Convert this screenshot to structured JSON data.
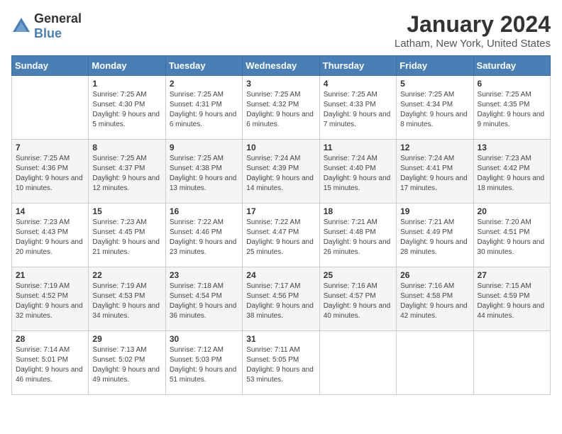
{
  "logo": {
    "general": "General",
    "blue": "Blue"
  },
  "title": "January 2024",
  "subtitle": "Latham, New York, United States",
  "headers": [
    "Sunday",
    "Monday",
    "Tuesday",
    "Wednesday",
    "Thursday",
    "Friday",
    "Saturday"
  ],
  "weeks": [
    [
      {
        "date": "",
        "sunrise": "",
        "sunset": "",
        "daylight": ""
      },
      {
        "date": "1",
        "sunrise": "Sunrise: 7:25 AM",
        "sunset": "Sunset: 4:30 PM",
        "daylight": "Daylight: 9 hours and 5 minutes."
      },
      {
        "date": "2",
        "sunrise": "Sunrise: 7:25 AM",
        "sunset": "Sunset: 4:31 PM",
        "daylight": "Daylight: 9 hours and 6 minutes."
      },
      {
        "date": "3",
        "sunrise": "Sunrise: 7:25 AM",
        "sunset": "Sunset: 4:32 PM",
        "daylight": "Daylight: 9 hours and 6 minutes."
      },
      {
        "date": "4",
        "sunrise": "Sunrise: 7:25 AM",
        "sunset": "Sunset: 4:33 PM",
        "daylight": "Daylight: 9 hours and 7 minutes."
      },
      {
        "date": "5",
        "sunrise": "Sunrise: 7:25 AM",
        "sunset": "Sunset: 4:34 PM",
        "daylight": "Daylight: 9 hours and 8 minutes."
      },
      {
        "date": "6",
        "sunrise": "Sunrise: 7:25 AM",
        "sunset": "Sunset: 4:35 PM",
        "daylight": "Daylight: 9 hours and 9 minutes."
      }
    ],
    [
      {
        "date": "7",
        "sunrise": "Sunrise: 7:25 AM",
        "sunset": "Sunset: 4:36 PM",
        "daylight": "Daylight: 9 hours and 10 minutes."
      },
      {
        "date": "8",
        "sunrise": "Sunrise: 7:25 AM",
        "sunset": "Sunset: 4:37 PM",
        "daylight": "Daylight: 9 hours and 12 minutes."
      },
      {
        "date": "9",
        "sunrise": "Sunrise: 7:25 AM",
        "sunset": "Sunset: 4:38 PM",
        "daylight": "Daylight: 9 hours and 13 minutes."
      },
      {
        "date": "10",
        "sunrise": "Sunrise: 7:24 AM",
        "sunset": "Sunset: 4:39 PM",
        "daylight": "Daylight: 9 hours and 14 minutes."
      },
      {
        "date": "11",
        "sunrise": "Sunrise: 7:24 AM",
        "sunset": "Sunset: 4:40 PM",
        "daylight": "Daylight: 9 hours and 15 minutes."
      },
      {
        "date": "12",
        "sunrise": "Sunrise: 7:24 AM",
        "sunset": "Sunset: 4:41 PM",
        "daylight": "Daylight: 9 hours and 17 minutes."
      },
      {
        "date": "13",
        "sunrise": "Sunrise: 7:23 AM",
        "sunset": "Sunset: 4:42 PM",
        "daylight": "Daylight: 9 hours and 18 minutes."
      }
    ],
    [
      {
        "date": "14",
        "sunrise": "Sunrise: 7:23 AM",
        "sunset": "Sunset: 4:43 PM",
        "daylight": "Daylight: 9 hours and 20 minutes."
      },
      {
        "date": "15",
        "sunrise": "Sunrise: 7:23 AM",
        "sunset": "Sunset: 4:45 PM",
        "daylight": "Daylight: 9 hours and 21 minutes."
      },
      {
        "date": "16",
        "sunrise": "Sunrise: 7:22 AM",
        "sunset": "Sunset: 4:46 PM",
        "daylight": "Daylight: 9 hours and 23 minutes."
      },
      {
        "date": "17",
        "sunrise": "Sunrise: 7:22 AM",
        "sunset": "Sunset: 4:47 PM",
        "daylight": "Daylight: 9 hours and 25 minutes."
      },
      {
        "date": "18",
        "sunrise": "Sunrise: 7:21 AM",
        "sunset": "Sunset: 4:48 PM",
        "daylight": "Daylight: 9 hours and 26 minutes."
      },
      {
        "date": "19",
        "sunrise": "Sunrise: 7:21 AM",
        "sunset": "Sunset: 4:49 PM",
        "daylight": "Daylight: 9 hours and 28 minutes."
      },
      {
        "date": "20",
        "sunrise": "Sunrise: 7:20 AM",
        "sunset": "Sunset: 4:51 PM",
        "daylight": "Daylight: 9 hours and 30 minutes."
      }
    ],
    [
      {
        "date": "21",
        "sunrise": "Sunrise: 7:19 AM",
        "sunset": "Sunset: 4:52 PM",
        "daylight": "Daylight: 9 hours and 32 minutes."
      },
      {
        "date": "22",
        "sunrise": "Sunrise: 7:19 AM",
        "sunset": "Sunset: 4:53 PM",
        "daylight": "Daylight: 9 hours and 34 minutes."
      },
      {
        "date": "23",
        "sunrise": "Sunrise: 7:18 AM",
        "sunset": "Sunset: 4:54 PM",
        "daylight": "Daylight: 9 hours and 36 minutes."
      },
      {
        "date": "24",
        "sunrise": "Sunrise: 7:17 AM",
        "sunset": "Sunset: 4:56 PM",
        "daylight": "Daylight: 9 hours and 38 minutes."
      },
      {
        "date": "25",
        "sunrise": "Sunrise: 7:16 AM",
        "sunset": "Sunset: 4:57 PM",
        "daylight": "Daylight: 9 hours and 40 minutes."
      },
      {
        "date": "26",
        "sunrise": "Sunrise: 7:16 AM",
        "sunset": "Sunset: 4:58 PM",
        "daylight": "Daylight: 9 hours and 42 minutes."
      },
      {
        "date": "27",
        "sunrise": "Sunrise: 7:15 AM",
        "sunset": "Sunset: 4:59 PM",
        "daylight": "Daylight: 9 hours and 44 minutes."
      }
    ],
    [
      {
        "date": "28",
        "sunrise": "Sunrise: 7:14 AM",
        "sunset": "Sunset: 5:01 PM",
        "daylight": "Daylight: 9 hours and 46 minutes."
      },
      {
        "date": "29",
        "sunrise": "Sunrise: 7:13 AM",
        "sunset": "Sunset: 5:02 PM",
        "daylight": "Daylight: 9 hours and 49 minutes."
      },
      {
        "date": "30",
        "sunrise": "Sunrise: 7:12 AM",
        "sunset": "Sunset: 5:03 PM",
        "daylight": "Daylight: 9 hours and 51 minutes."
      },
      {
        "date": "31",
        "sunrise": "Sunrise: 7:11 AM",
        "sunset": "Sunset: 5:05 PM",
        "daylight": "Daylight: 9 hours and 53 minutes."
      },
      {
        "date": "",
        "sunrise": "",
        "sunset": "",
        "daylight": ""
      },
      {
        "date": "",
        "sunrise": "",
        "sunset": "",
        "daylight": ""
      },
      {
        "date": "",
        "sunrise": "",
        "sunset": "",
        "daylight": ""
      }
    ]
  ]
}
